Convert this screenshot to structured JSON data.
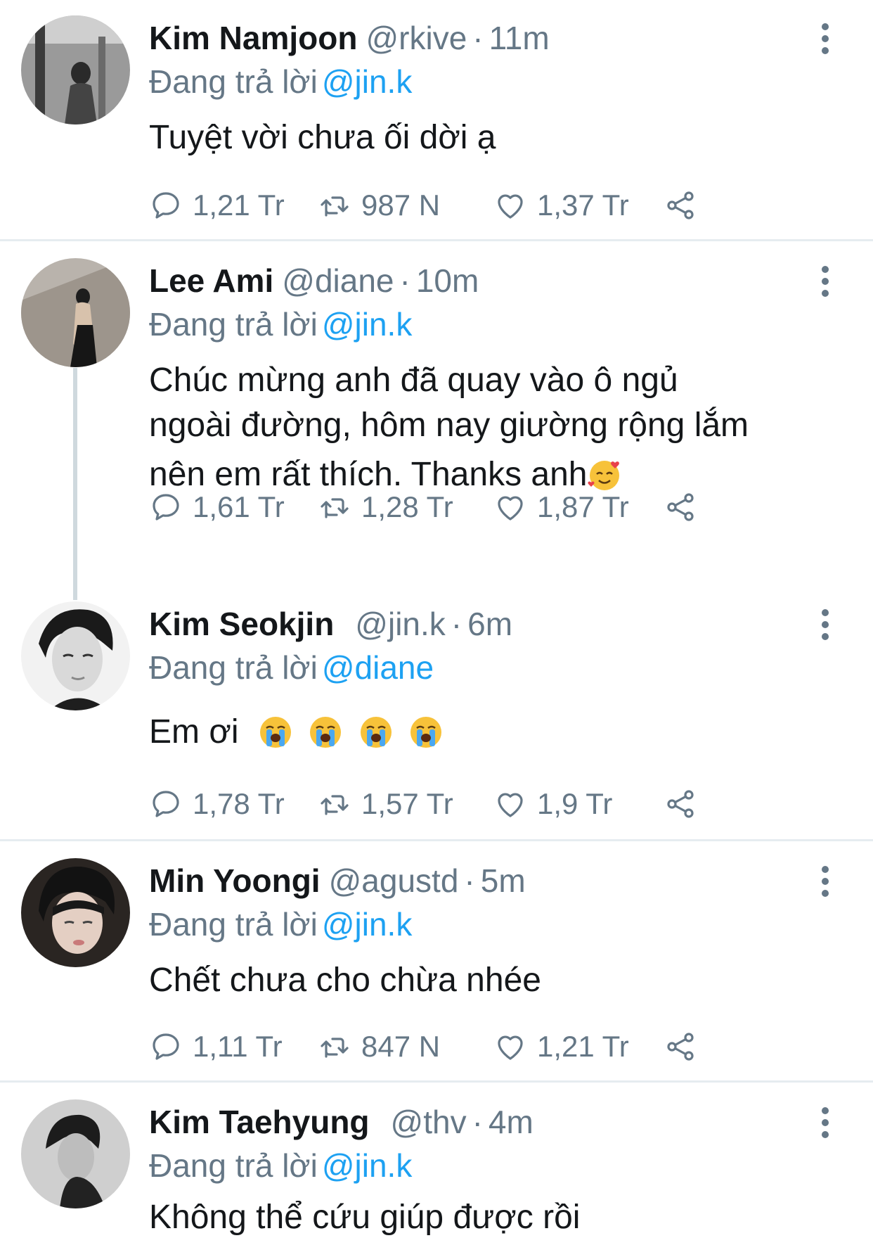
{
  "tweets": [
    {
      "name": "Kim Namjoon",
      "handle": "@rkive",
      "time": "11m",
      "reply_prefix": "Đang trả lời",
      "reply_to": "@jin.k",
      "text": "Tuyệt vời chưa ối dời ạ",
      "replies": "1,21 Tr",
      "retweets": "987 N",
      "likes": "1,37 Tr"
    },
    {
      "name": "Lee Ami",
      "handle": "@diane",
      "time": "10m",
      "reply_prefix": "Đang trả lời",
      "reply_to": "@jin.k",
      "text_line1": "Chúc mừng anh đã quay vào ô ngủ",
      "text_line2": "ngoài đường, hôm nay giường rộng lắm",
      "text_line3": "nên em rất thích. Thanks anh",
      "emoji": "smiling-face-with-hearts",
      "replies": "1,61 Tr",
      "retweets": "1,28 Tr",
      "likes": "1,87 Tr"
    },
    {
      "name": "Kim Seokjin",
      "handle": "@jin.k",
      "time": "6m",
      "reply_prefix": "Đang trả lời",
      "reply_to": "@diane",
      "text": "Em ơi",
      "emoji": "loudly-crying-face",
      "replies": "1,78 Tr",
      "retweets": "1,57 Tr",
      "likes": "1,9 Tr"
    },
    {
      "name": "Min Yoongi",
      "handle": "@agustd",
      "time": "5m",
      "reply_prefix": "Đang trả lời",
      "reply_to": "@jin.k",
      "text": "Chết chưa cho chừa nhée",
      "replies": "1,11 Tr",
      "retweets": "847 N",
      "likes": "1,21 Tr"
    },
    {
      "name": "Kim Taehyung",
      "handle": "@thv",
      "time": "4m",
      "reply_prefix": "Đang trả lời",
      "reply_to": "@jin.k",
      "text": "Không thể cứu giúp được rồi"
    }
  ],
  "separator": "·",
  "colors": {
    "name": "#14171a",
    "secondary": "#657786",
    "mention": "#1da1f2",
    "divider": "#e6ecf0",
    "thread_line": "#cfd9de"
  },
  "icons": [
    "reply-icon",
    "retweet-icon",
    "like-icon",
    "share-icon",
    "more-icon"
  ]
}
